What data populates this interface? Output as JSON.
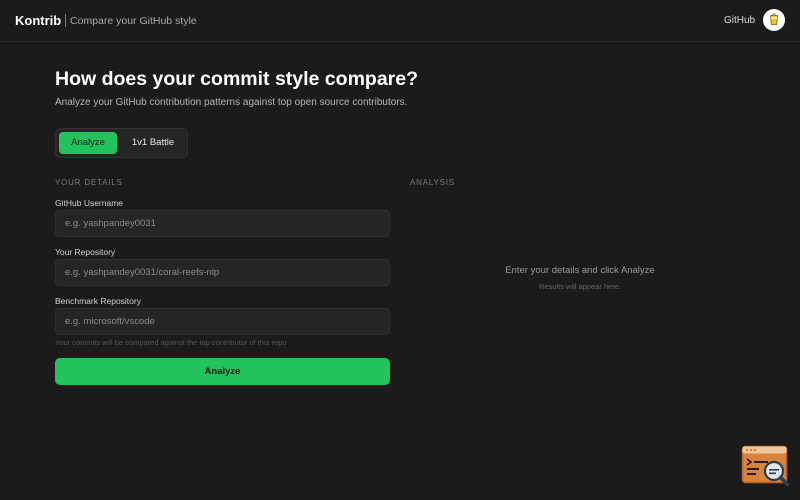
{
  "header": {
    "brand": "Kontrib",
    "tagline": "Compare your GitHub style",
    "github_link": "GitHub",
    "avatar_icon": "cup-icon"
  },
  "hero": {
    "title": "How does your commit style compare?",
    "subtitle": "Analyze your GitHub contribution patterns against top open source contributors."
  },
  "tabs": {
    "items": [
      {
        "label": "Analyze",
        "active": true
      },
      {
        "label": "1v1 Battle",
        "active": false
      }
    ]
  },
  "form": {
    "section_label": "YOUR DETAILS",
    "username": {
      "label": "GitHub Username",
      "value": "",
      "placeholder": "e.g. yashpandey0031"
    },
    "repository": {
      "label": "Your Repository",
      "value": "",
      "placeholder": "e.g. yashpandey0031/coral-reefs-nlp"
    },
    "benchmark": {
      "label": "Benchmark Repository",
      "value": "",
      "placeholder": "e.g. microsoft/vscode"
    },
    "hint": "Your commits will be compared against the top contributor of this repo",
    "submit_label": "Analyze"
  },
  "analysis": {
    "section_label": "ANALYSIS",
    "empty_title": "Enter your details and click Analyze",
    "empty_subtitle": "Results will appear here."
  },
  "colors": {
    "background": "#1b1b1b",
    "accent": "#23c25c",
    "input_bg": "#252525"
  },
  "floating_widget": {
    "icon": "terminal-search-icon"
  }
}
